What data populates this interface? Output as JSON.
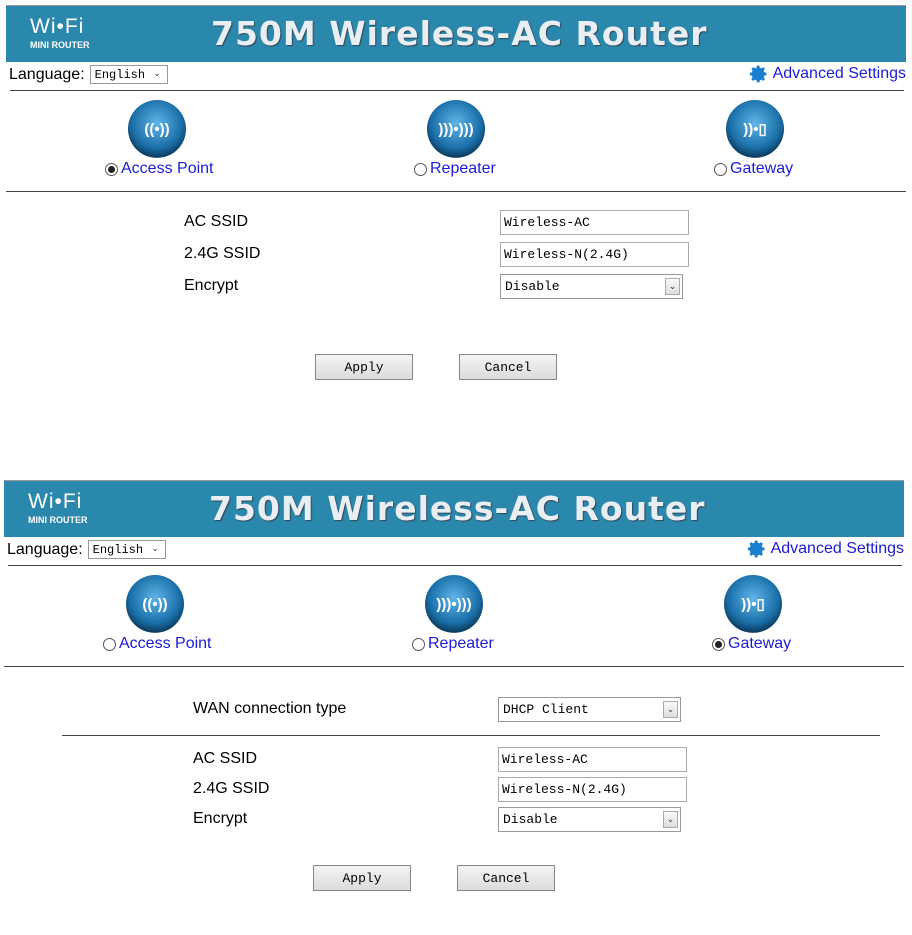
{
  "header": {
    "logo_wifi": "Wi•Fi",
    "logo_sub": "MINI ROUTER",
    "title": "750M Wireless-AC Router"
  },
  "colors": {
    "header_bg": "#2b88ad",
    "link": "#1b1bd9"
  },
  "panels": [
    {
      "language_label": "Language:",
      "language_value": "English",
      "advanced": "Advanced Settings",
      "modes": [
        {
          "label": "Access Point",
          "icon": "access-point-icon",
          "selected": true
        },
        {
          "label": "Repeater",
          "icon": "repeater-icon",
          "selected": false
        },
        {
          "label": "Gateway",
          "icon": "gateway-icon",
          "selected": false
        }
      ],
      "fields": {
        "ac_ssid_label": "AC SSID",
        "ac_ssid": "Wireless-AC",
        "g24_ssid_label": "2.4G SSID",
        "g24_ssid": "Wireless-N(2.4G)",
        "encrypt_label": "Encrypt",
        "encrypt": "Disable"
      },
      "apply": "Apply",
      "cancel": "Cancel"
    },
    {
      "language_label": "Language:",
      "language_value": "English",
      "advanced": "Advanced Settings",
      "modes": [
        {
          "label": "Access Point",
          "icon": "access-point-icon",
          "selected": false
        },
        {
          "label": "Repeater",
          "icon": "repeater-icon",
          "selected": false
        },
        {
          "label": "Gateway",
          "icon": "gateway-icon",
          "selected": true
        }
      ],
      "fields": {
        "wan_label": "WAN connection type",
        "wan": "DHCP Client",
        "ac_ssid_label": "AC SSID",
        "ac_ssid": "Wireless-AC",
        "g24_ssid_label": "2.4G SSID",
        "g24_ssid": "Wireless-N(2.4G)",
        "encrypt_label": "Encrypt",
        "encrypt": "Disable"
      },
      "apply": "Apply",
      "cancel": "Cancel"
    }
  ]
}
